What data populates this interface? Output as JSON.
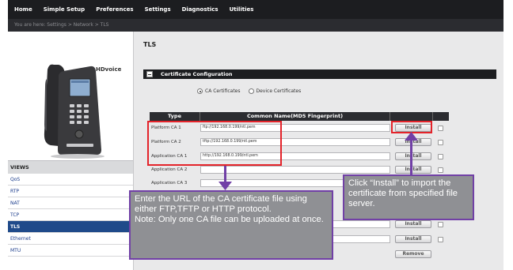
{
  "nav": {
    "items": [
      "Home",
      "Simple Setup",
      "Preferences",
      "Settings",
      "Diagnostics",
      "Utilities"
    ],
    "breadcrumb": "You are here: Settings > Network > TLS"
  },
  "phone": {
    "brand": "HDvoice"
  },
  "sidebar": {
    "heading": "VIEWS",
    "items": [
      "QoS",
      "RTP",
      "NAT",
      "TCP",
      "TLS",
      "Ethernet",
      "MTU"
    ],
    "active": "TLS"
  },
  "main": {
    "title": "TLS",
    "section_title": "Certificate Configuration",
    "radio_options": [
      "CA Certificates",
      "Device Certificates"
    ],
    "selected_radio": "CA Certificates",
    "table": {
      "headers": [
        "Type",
        "Common Name(MD5 Fingerprint)"
      ],
      "rows": [
        {
          "type": "Platform CA 1",
          "url": "ftp://192.168.0.199/ntl.pem",
          "button": "Install"
        },
        {
          "type": "Platform CA 2",
          "url": "tftp://192.168.0.199/ntl.pem",
          "button": "Install"
        },
        {
          "type": "Application CA 1",
          "url": "http://192.168.0.199/ntl.pem",
          "button": "Install"
        },
        {
          "type": "Application CA 2",
          "url": "",
          "button": "Install"
        },
        {
          "type": "Application CA 3",
          "url": "",
          "button": ""
        },
        {
          "type": "",
          "url": "",
          "button": "Install"
        },
        {
          "type": "",
          "url": "",
          "button": "Install"
        },
        {
          "type": "",
          "url": "",
          "button": "Remove"
        }
      ]
    }
  },
  "callouts": {
    "left": "Enter the URL of the CA certificate file using either FTP,TFTP or HTTP protocol.\nNote: Only one CA file can be uploaded at once.",
    "right": "Click “Install” to import the certificate from specified file server."
  },
  "colors": {
    "highlight": "#e4232a",
    "callout_border": "#7140a6",
    "callout_fill": "#8f9094",
    "nav_bg": "#1c1d20",
    "active_view": "#1f4a8a"
  }
}
